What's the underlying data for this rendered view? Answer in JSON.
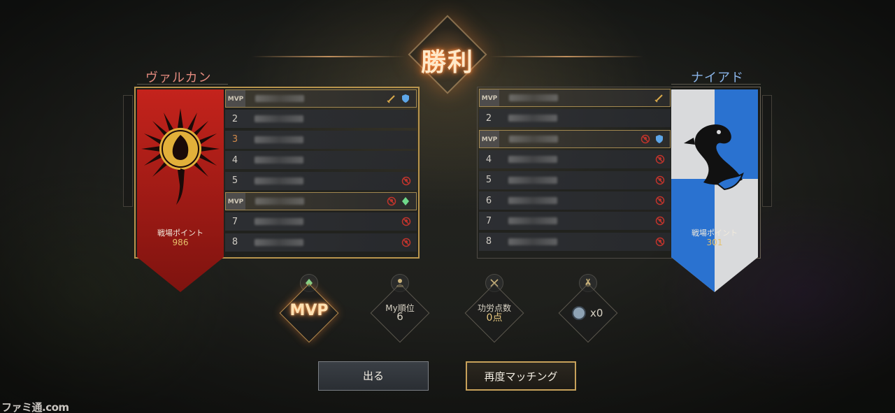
{
  "title": "勝利",
  "teams": {
    "left": {
      "name": "ヴァルカン",
      "points_label": "戦場ポイント",
      "points": "986",
      "color": "#b3201a",
      "players": [
        {
          "rank": "MVP",
          "icons": [
            "sword-icon",
            "shield-icon"
          ]
        },
        {
          "rank": "2",
          "icons": []
        },
        {
          "rank": "3",
          "icons": []
        },
        {
          "rank": "4",
          "icons": []
        },
        {
          "rank": "5",
          "icons": [
            "no-skull-icon"
          ]
        },
        {
          "rank": "MVP",
          "icons": [
            "no-skull-icon",
            "crystal-icon"
          ]
        },
        {
          "rank": "7",
          "icons": [
            "no-skull-icon"
          ]
        },
        {
          "rank": "8",
          "icons": [
            "no-skull-icon"
          ]
        }
      ]
    },
    "right": {
      "name": "ナイアド",
      "points_label": "戦場ポイント",
      "points": "301",
      "color": "#1f66c9",
      "players": [
        {
          "rank": "MVP",
          "icons": [
            "sword-icon"
          ]
        },
        {
          "rank": "2",
          "icons": []
        },
        {
          "rank": "MVP",
          "icons": [
            "no-skull-icon",
            "shield-icon"
          ]
        },
        {
          "rank": "4",
          "icons": [
            "no-skull-icon"
          ]
        },
        {
          "rank": "5",
          "icons": [
            "no-skull-icon"
          ]
        },
        {
          "rank": "6",
          "icons": [
            "no-skull-icon"
          ]
        },
        {
          "rank": "7",
          "icons": [
            "no-skull-icon"
          ]
        },
        {
          "rank": "8",
          "icons": [
            "no-skull-icon"
          ]
        }
      ]
    }
  },
  "stats": {
    "mvp": {
      "label": "MVP"
    },
    "rank": {
      "label": "My順位",
      "value": "6"
    },
    "merit": {
      "label": "功労点数",
      "value": "0点"
    },
    "medal": {
      "value": "x0"
    }
  },
  "buttons": {
    "exit": "出る",
    "rematch": "再度マッチング"
  },
  "watermark": "ファミ通.com",
  "colors": {
    "accent_gold": "#c7a15a",
    "left_team": "#e38a7e",
    "right_team": "#8ab4e8"
  }
}
